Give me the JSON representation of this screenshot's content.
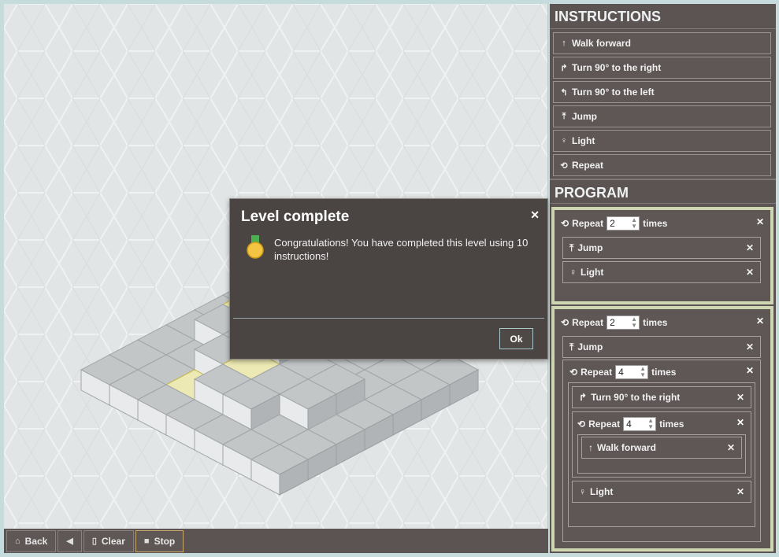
{
  "toolbar": {
    "back_label": "Back",
    "clear_label": "Clear",
    "stop_label": "Stop"
  },
  "instructions": {
    "title": "INSTRUCTIONS",
    "items": [
      {
        "icon": "↑",
        "label": "Walk forward"
      },
      {
        "icon": "↱",
        "label": "Turn 90° to the right"
      },
      {
        "icon": "↰",
        "label": "Turn 90° to the left"
      },
      {
        "icon": "⤒",
        "label": "Jump"
      },
      {
        "icon": "♀",
        "label": "Light"
      },
      {
        "icon": "⟲",
        "label": "Repeat"
      }
    ]
  },
  "program": {
    "title": "PROGRAM",
    "repeat_label": "Repeat",
    "times_label": "times",
    "block1": {
      "count": "2",
      "jump": "Jump",
      "light": "Light"
    },
    "block2": {
      "count": "2",
      "jump": "Jump",
      "inner_count": "4",
      "turn_right": "Turn 90° to the right",
      "inner2_count": "4",
      "walk": "Walk forward",
      "light": "Light"
    }
  },
  "dialog": {
    "title": "Level complete",
    "message": "Congratulations! You have completed this level using 10 instructions!",
    "ok_label": "Ok"
  },
  "colors": {
    "panel_bg": "#5b5453",
    "highlight_border": "#cfd6b2",
    "lit_tile": "#ede9b4",
    "dialog_bg": "#4a4443"
  }
}
